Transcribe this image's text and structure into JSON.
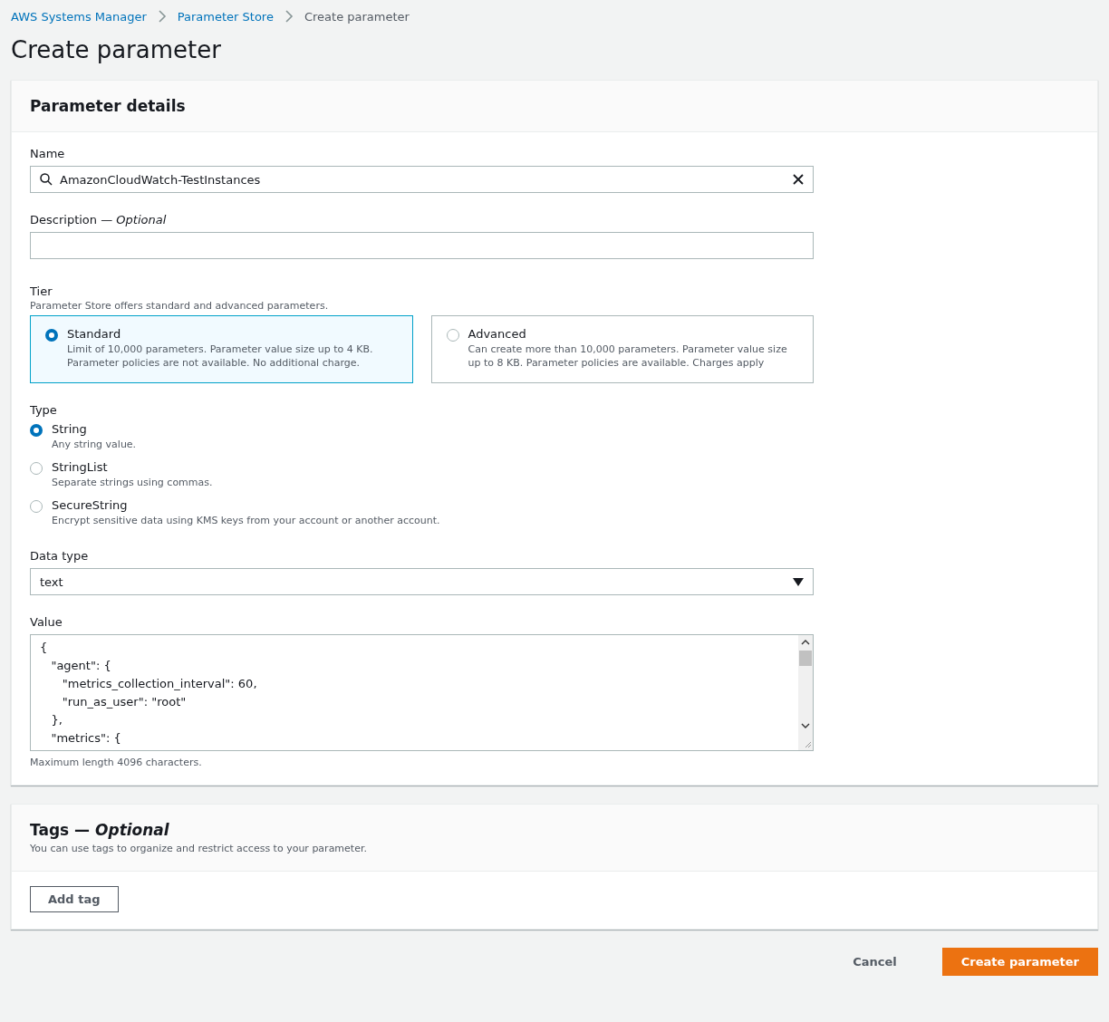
{
  "breadcrumbs": [
    {
      "label": "AWS Systems Manager",
      "link": true
    },
    {
      "label": "Parameter Store",
      "link": true
    },
    {
      "label": "Create parameter",
      "link": false
    }
  ],
  "title": "Create parameter",
  "details": {
    "heading": "Parameter details",
    "name": {
      "label": "Name",
      "value": "AmazonCloudWatch-TestInstances"
    },
    "description": {
      "label": "Description — *Optional*"
    },
    "tier": {
      "label": "Tier",
      "hint": "Parameter Store offers standard and advanced parameters.",
      "options": [
        {
          "label": "Standard",
          "description": "Limit of 10,000 parameters. Parameter value size up to 4 KB. Parameter policies are not available. No additional charge.",
          "selected": true
        },
        {
          "label": "Advanced",
          "description": "Can create more than 10,000 parameters. Parameter value size up to 8 KB. Parameter policies are available. Charges apply",
          "selected": false
        }
      ]
    },
    "type": {
      "label": "Type",
      "options": [
        {
          "label": "String",
          "description": "Any string value.",
          "selected": true
        },
        {
          "label": "StringList",
          "description": "Separate strings using commas.",
          "selected": false
        },
        {
          "label": "SecureString",
          "description": "Encrypt sensitive data using KMS keys from your account or another account.",
          "selected": false
        }
      ]
    },
    "data_type": {
      "label": "Data type",
      "value": "text"
    },
    "value": {
      "label": "Value",
      "value": "{\n   \"agent\": {\n      \"metrics_collection_interval\": 60,\n      \"run_as_user\": \"root\"\n   },\n   \"metrics\": {",
      "hint": "Maximum length 4096 characters."
    }
  },
  "tags": {
    "heading": "Tags — *Optional*",
    "description": "You can use tags to organize and restrict access to your parameter.",
    "button": "Add tag"
  },
  "actions": {
    "cancel": "Cancel",
    "submit": "Create parameter"
  }
}
